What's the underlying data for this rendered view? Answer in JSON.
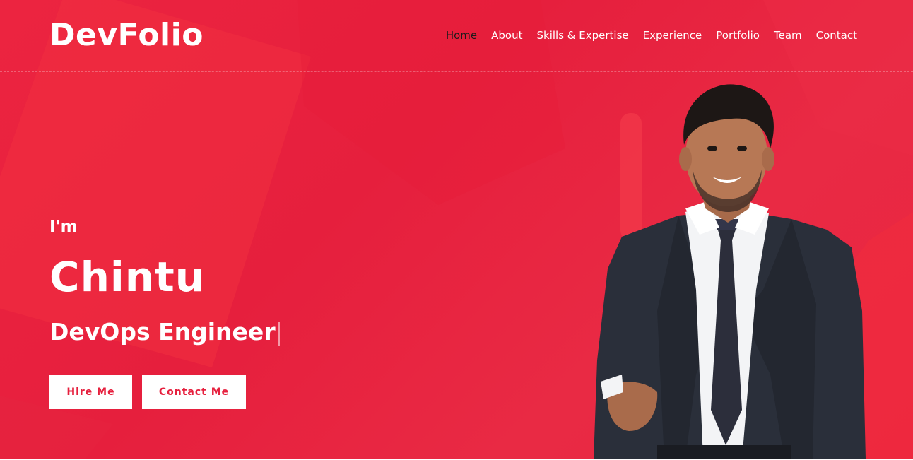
{
  "header": {
    "logo": "DevFolio",
    "nav": [
      {
        "label": "Home",
        "active": true
      },
      {
        "label": "About"
      },
      {
        "label": "Skills & Expertise"
      },
      {
        "label": "Experience"
      },
      {
        "label": "Portfolio"
      },
      {
        "label": "Team"
      },
      {
        "label": "Contact"
      }
    ]
  },
  "hero": {
    "intro": "I'm",
    "name": "Chintu",
    "role": "DevOps Engineer",
    "buttons": {
      "hire": "Hire Me",
      "contact": "Contact Me"
    },
    "photo_icon": "person-portrait-icon"
  },
  "colors": {
    "accent": "#e61f3d",
    "text_light": "#ffffff",
    "nav_active": "#1b1b1b"
  }
}
